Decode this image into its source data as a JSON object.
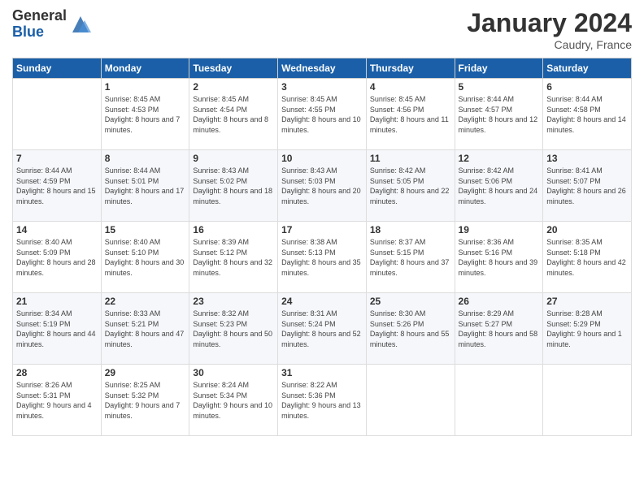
{
  "logo": {
    "general": "General",
    "blue": "Blue"
  },
  "header": {
    "month": "January 2024",
    "location": "Caudry, France"
  },
  "days_of_week": [
    "Sunday",
    "Monday",
    "Tuesday",
    "Wednesday",
    "Thursday",
    "Friday",
    "Saturday"
  ],
  "weeks": [
    [
      {
        "day": "",
        "sunrise": "",
        "sunset": "",
        "daylight": ""
      },
      {
        "day": "1",
        "sunrise": "8:45 AM",
        "sunset": "4:53 PM",
        "daylight": "8 hours and 7 minutes."
      },
      {
        "day": "2",
        "sunrise": "8:45 AM",
        "sunset": "4:54 PM",
        "daylight": "8 hours and 8 minutes."
      },
      {
        "day": "3",
        "sunrise": "8:45 AM",
        "sunset": "4:55 PM",
        "daylight": "8 hours and 10 minutes."
      },
      {
        "day": "4",
        "sunrise": "8:45 AM",
        "sunset": "4:56 PM",
        "daylight": "8 hours and 11 minutes."
      },
      {
        "day": "5",
        "sunrise": "8:44 AM",
        "sunset": "4:57 PM",
        "daylight": "8 hours and 12 minutes."
      },
      {
        "day": "6",
        "sunrise": "8:44 AM",
        "sunset": "4:58 PM",
        "daylight": "8 hours and 14 minutes."
      }
    ],
    [
      {
        "day": "7",
        "sunrise": "8:44 AM",
        "sunset": "4:59 PM",
        "daylight": "8 hours and 15 minutes."
      },
      {
        "day": "8",
        "sunrise": "8:44 AM",
        "sunset": "5:01 PM",
        "daylight": "8 hours and 17 minutes."
      },
      {
        "day": "9",
        "sunrise": "8:43 AM",
        "sunset": "5:02 PM",
        "daylight": "8 hours and 18 minutes."
      },
      {
        "day": "10",
        "sunrise": "8:43 AM",
        "sunset": "5:03 PM",
        "daylight": "8 hours and 20 minutes."
      },
      {
        "day": "11",
        "sunrise": "8:42 AM",
        "sunset": "5:05 PM",
        "daylight": "8 hours and 22 minutes."
      },
      {
        "day": "12",
        "sunrise": "8:42 AM",
        "sunset": "5:06 PM",
        "daylight": "8 hours and 24 minutes."
      },
      {
        "day": "13",
        "sunrise": "8:41 AM",
        "sunset": "5:07 PM",
        "daylight": "8 hours and 26 minutes."
      }
    ],
    [
      {
        "day": "14",
        "sunrise": "8:40 AM",
        "sunset": "5:09 PM",
        "daylight": "8 hours and 28 minutes."
      },
      {
        "day": "15",
        "sunrise": "8:40 AM",
        "sunset": "5:10 PM",
        "daylight": "8 hours and 30 minutes."
      },
      {
        "day": "16",
        "sunrise": "8:39 AM",
        "sunset": "5:12 PM",
        "daylight": "8 hours and 32 minutes."
      },
      {
        "day": "17",
        "sunrise": "8:38 AM",
        "sunset": "5:13 PM",
        "daylight": "8 hours and 35 minutes."
      },
      {
        "day": "18",
        "sunrise": "8:37 AM",
        "sunset": "5:15 PM",
        "daylight": "8 hours and 37 minutes."
      },
      {
        "day": "19",
        "sunrise": "8:36 AM",
        "sunset": "5:16 PM",
        "daylight": "8 hours and 39 minutes."
      },
      {
        "day": "20",
        "sunrise": "8:35 AM",
        "sunset": "5:18 PM",
        "daylight": "8 hours and 42 minutes."
      }
    ],
    [
      {
        "day": "21",
        "sunrise": "8:34 AM",
        "sunset": "5:19 PM",
        "daylight": "8 hours and 44 minutes."
      },
      {
        "day": "22",
        "sunrise": "8:33 AM",
        "sunset": "5:21 PM",
        "daylight": "8 hours and 47 minutes."
      },
      {
        "day": "23",
        "sunrise": "8:32 AM",
        "sunset": "5:23 PM",
        "daylight": "8 hours and 50 minutes."
      },
      {
        "day": "24",
        "sunrise": "8:31 AM",
        "sunset": "5:24 PM",
        "daylight": "8 hours and 52 minutes."
      },
      {
        "day": "25",
        "sunrise": "8:30 AM",
        "sunset": "5:26 PM",
        "daylight": "8 hours and 55 minutes."
      },
      {
        "day": "26",
        "sunrise": "8:29 AM",
        "sunset": "5:27 PM",
        "daylight": "8 hours and 58 minutes."
      },
      {
        "day": "27",
        "sunrise": "8:28 AM",
        "sunset": "5:29 PM",
        "daylight": "9 hours and 1 minute."
      }
    ],
    [
      {
        "day": "28",
        "sunrise": "8:26 AM",
        "sunset": "5:31 PM",
        "daylight": "9 hours and 4 minutes."
      },
      {
        "day": "29",
        "sunrise": "8:25 AM",
        "sunset": "5:32 PM",
        "daylight": "9 hours and 7 minutes."
      },
      {
        "day": "30",
        "sunrise": "8:24 AM",
        "sunset": "5:34 PM",
        "daylight": "9 hours and 10 minutes."
      },
      {
        "day": "31",
        "sunrise": "8:22 AM",
        "sunset": "5:36 PM",
        "daylight": "9 hours and 13 minutes."
      },
      {
        "day": "",
        "sunrise": "",
        "sunset": "",
        "daylight": ""
      },
      {
        "day": "",
        "sunrise": "",
        "sunset": "",
        "daylight": ""
      },
      {
        "day": "",
        "sunrise": "",
        "sunset": "",
        "daylight": ""
      }
    ]
  ]
}
